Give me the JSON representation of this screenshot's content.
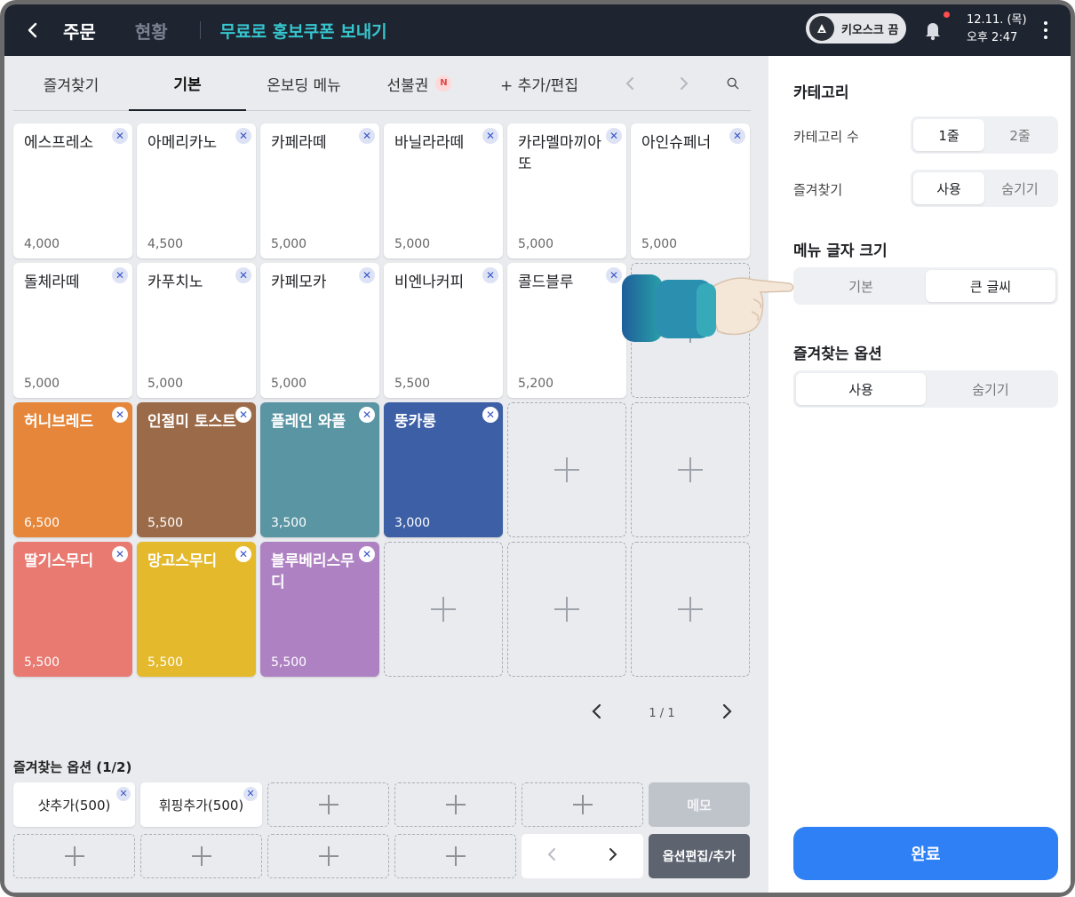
{
  "header": {
    "title": "주문",
    "status": "현황",
    "promo": "무료로 홍보쿠폰 보내기",
    "kiosk_label": "키오스크 끔",
    "date": "12.11. (목)",
    "time": "오후 2:47"
  },
  "tabs": [
    {
      "label": "즐겨찾기"
    },
    {
      "label": "기본"
    },
    {
      "label": "온보딩 메뉴"
    },
    {
      "label": "선불권",
      "badge": "N"
    },
    {
      "label": "+ 추가/편집"
    }
  ],
  "menu_items": [
    {
      "name": "에스프레소",
      "price": "4,000"
    },
    {
      "name": "아메리카노",
      "price": "4,500"
    },
    {
      "name": "카페라떼",
      "price": "5,000"
    },
    {
      "name": "바닐라라떼",
      "price": "5,000"
    },
    {
      "name": "카라멜마끼아또",
      "price": "5,000"
    },
    {
      "name": "아인슈페너",
      "price": "5,000"
    },
    {
      "name": "돌체라떼",
      "price": "5,000"
    },
    {
      "name": "카푸치노",
      "price": "5,000"
    },
    {
      "name": "카페모카",
      "price": "5,000"
    },
    {
      "name": "비엔나커피",
      "price": "5,500"
    },
    {
      "name": "콜드블루",
      "price": "5,200"
    },
    {
      "name": "허니브레드",
      "price": "6,500",
      "color": "#e5863a"
    },
    {
      "name": "인절미 토스트",
      "price": "5,500",
      "color": "#9b6b49"
    },
    {
      "name": "플레인 와플",
      "price": "3,500",
      "color": "#5995a3"
    },
    {
      "name": "뚱카롱",
      "price": "3,000",
      "color": "#3d5fa6"
    },
    {
      "name": "딸기스무디",
      "price": "5,500",
      "color": "#e87a72"
    },
    {
      "name": "망고스무디",
      "price": "5,500",
      "color": "#e4b92c"
    },
    {
      "name": "블루베리스무디",
      "price": "5,500",
      "color": "#ae82c2"
    }
  ],
  "pager": {
    "label": "1 / 1"
  },
  "favorite_options": {
    "title": "즐겨찾는 옵션 (1/2)",
    "items": [
      {
        "name": "샷추가(500)"
      },
      {
        "name": "휘핑추가(500)"
      }
    ],
    "memo_label": "메모",
    "edit_label": "옵션편집/추가"
  },
  "panel": {
    "category_title": "카테고리",
    "category_count_label": "카테고리 수",
    "category_count_options": [
      "1줄",
      "2줄"
    ],
    "favorites_label": "즐겨찾기",
    "favorites_options": [
      "사용",
      "숨기기"
    ],
    "font_size_title": "메뉴 글자 크기",
    "font_size_options": [
      "기본",
      "큰 글씨"
    ],
    "fav_options_title": "즐겨찾는 옵션",
    "fav_options_options": [
      "사용",
      "숨기기"
    ],
    "done_label": "완료"
  },
  "colors": {
    "accent": "#2f80f5",
    "header_bg": "#1f2530",
    "promo": "#36c6cf"
  }
}
